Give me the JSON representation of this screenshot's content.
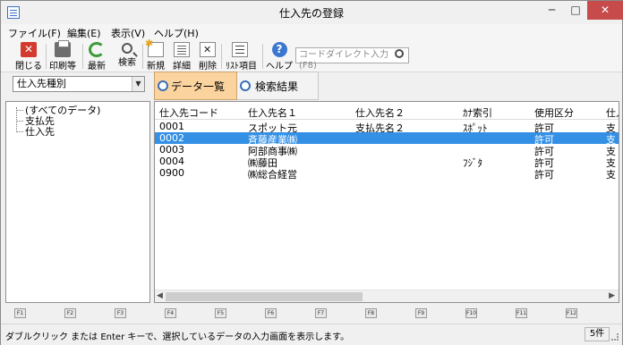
{
  "window": {
    "title": "仕入先の登録"
  },
  "window_controls": {
    "minimize": "─",
    "maximize": "□",
    "close": "✕"
  },
  "menu": [
    {
      "label": "ファイル(F)"
    },
    {
      "label": "編集(E)"
    },
    {
      "label": "表示(V)"
    },
    {
      "label": "ヘルプ(H)"
    }
  ],
  "toolbar": {
    "close_label": "閉じる",
    "print_label": "印刷等",
    "refresh_label": "最新",
    "search_label": "検索",
    "new_label": "新規",
    "detail_label": "詳細",
    "delete_label": "削除",
    "list_items_label": "ﾘｽﾄ項目",
    "help_label": "ヘルプ",
    "direct_input_placeholder": "コードダイレクト入力(F8)"
  },
  "category_select": {
    "value": "仕入先種別",
    "arrow": "▼"
  },
  "tabs": [
    {
      "label": "データ一覧",
      "active": true
    },
    {
      "label": "検索結果",
      "active": false
    }
  ],
  "tree": [
    {
      "label": "(すべてのデータ)"
    },
    {
      "label": "支払先"
    },
    {
      "label": "仕入先"
    }
  ],
  "grid": {
    "columns": [
      "仕入先コード",
      "仕入先名１",
      "仕入先名２",
      "ｶﾅ索引",
      "使用区分",
      "仕入"
    ],
    "rows": [
      {
        "code": "0001",
        "name1": "スポット元",
        "name2": "支払先名２",
        "kana": "ｽﾎﾟｯﾄ",
        "usage": "許可",
        "extra": "支"
      },
      {
        "code": "0002",
        "name1": "斉藤産業㈱",
        "name2": "",
        "kana": "",
        "usage": "許可",
        "extra": "支"
      },
      {
        "code": "0003",
        "name1": "阿部商事㈱",
        "name2": "",
        "kana": "",
        "usage": "許可",
        "extra": "支"
      },
      {
        "code": "0004",
        "name1": "㈱藤田",
        "name2": "",
        "kana": "ﾌｼﾞﾀ",
        "usage": "許可",
        "extra": "支"
      },
      {
        "code": "0900",
        "name1": "㈱総合経営",
        "name2": "",
        "kana": "",
        "usage": "許可",
        "extra": "支"
      }
    ],
    "selected_row": 1,
    "scroll_left": "◀",
    "scroll_right": "▶"
  },
  "function_keys": [
    "F1",
    "F2",
    "F3",
    "F4",
    "F5",
    "F6",
    "F7",
    "F8",
    "F9",
    "F10",
    "F11",
    "F12"
  ],
  "status": {
    "message": "ダブルクリック または Enter キーで、選択しているデータの入力画面を表示します。",
    "count": "5件"
  },
  "colors": {
    "active_tab": "#fbd39e",
    "selection": "#3390e5",
    "close_button": "#c74b4b"
  }
}
